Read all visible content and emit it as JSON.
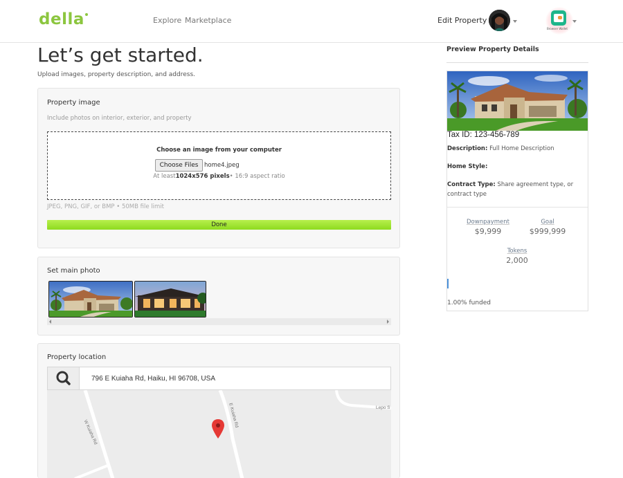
{
  "header": {
    "logo": "della",
    "nav": [
      {
        "label": "Explore"
      },
      {
        "label": "Marketplace"
      }
    ],
    "edit_property": "Edit Property",
    "wallet_label": "Browser Wallet"
  },
  "page": {
    "title": "Let’s get started.",
    "subtitle": "Upload images, property description, and address."
  },
  "property_image": {
    "title": "Property image",
    "hint": "Include photos on interior, exterior, and property",
    "dropzone_title": "Choose an image from your computer",
    "choose_button": "Choose Files",
    "filename": "home4.jpeg",
    "req_prefix": "At least",
    "req_size": "1024x576 pixels",
    "req_suffix": "• 16:9 aspect ratio",
    "formats": "JPEG, PNG, GIF, or BMP • 50MB file limit",
    "done_button": "Done"
  },
  "main_photo": {
    "title": "Set main photo"
  },
  "location": {
    "title": "Property location",
    "address": "796 E Kuiaha Rd, Haiku, HI 96708, USA",
    "map_labels": {
      "road1": "W Kuiaha Rd",
      "road2": "E Kuiaha Rd",
      "road3": "Lepo S"
    }
  },
  "preview": {
    "title": "Preview Property Details",
    "tax_id": "Tax ID: 123-456-789",
    "description_label": "Description:",
    "description_value": "Full Home Description",
    "home_style_label": "Home Style:",
    "home_style_value": "",
    "contract_label": "Contract Type:",
    "contract_value": "Share agreement type, or contract type",
    "downpayment_label": "Downpayment",
    "downpayment_value": "$9,999",
    "goal_label": "Goal",
    "goal_value": "$999,999",
    "tokens_label": "Tokens",
    "tokens_value": "2,000",
    "funded_percent": 1,
    "funded_text": "1.00% funded"
  },
  "colors": {
    "brand": "#8cc63f",
    "done_button": "#a5e63a",
    "progress": "#4a90d9",
    "wallet": "#1db68b"
  }
}
